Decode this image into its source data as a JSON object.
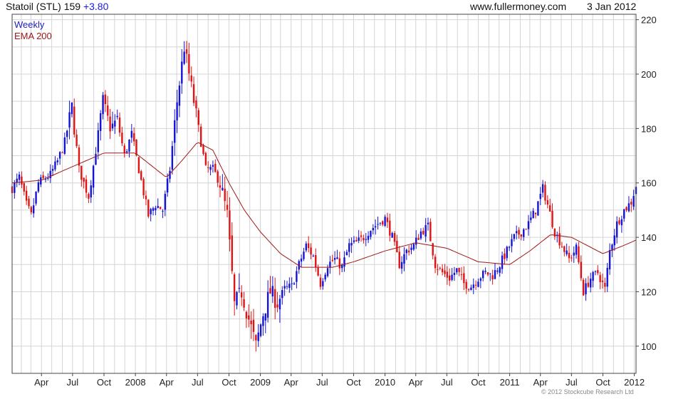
{
  "header": {
    "title": "Statoil (STL) 159",
    "change": "+3.80",
    "website": "www.fullermoney.com",
    "date": "3 Jan 2012"
  },
  "footer": {
    "copyright": "© 2012 Stockcube Research Ltd"
  },
  "colors": {
    "up": "#1414d8",
    "down": "#e01414",
    "ema": "#a01818",
    "grid": "#d4d4d4",
    "frame": "#444444"
  },
  "chart_data": {
    "type": "candlestick",
    "period": "Weekly",
    "legend": [
      "Weekly",
      "EMA 200"
    ],
    "ylim": [
      90,
      222
    ],
    "yticks": [
      100,
      120,
      140,
      160,
      180,
      200,
      220
    ],
    "xlim": [
      "2007-01-05",
      "2012-01-06"
    ],
    "xticks": [
      {
        "label": "Apr",
        "date": "2007-04-01"
      },
      {
        "label": "Jul",
        "date": "2007-07-01"
      },
      {
        "label": "Oct",
        "date": "2007-10-01"
      },
      {
        "label": "2008",
        "date": "2008-01-01"
      },
      {
        "label": "Apr",
        "date": "2008-04-01"
      },
      {
        "label": "Jul",
        "date": "2008-07-01"
      },
      {
        "label": "Oct",
        "date": "2008-10-01"
      },
      {
        "label": "2009",
        "date": "2009-01-01"
      },
      {
        "label": "Apr",
        "date": "2009-04-01"
      },
      {
        "label": "Jul",
        "date": "2009-07-01"
      },
      {
        "label": "Oct",
        "date": "2009-10-01"
      },
      {
        "label": "2010",
        "date": "2010-01-01"
      },
      {
        "label": "Apr",
        "date": "2010-04-01"
      },
      {
        "label": "Jul",
        "date": "2010-07-01"
      },
      {
        "label": "Oct",
        "date": "2010-10-01"
      },
      {
        "label": "2011",
        "date": "2011-01-01"
      },
      {
        "label": "Apr",
        "date": "2011-04-01"
      },
      {
        "label": "Jul",
        "date": "2011-07-01"
      },
      {
        "label": "Oct",
        "date": "2011-10-01"
      },
      {
        "label": "2012",
        "date": "2012-01-01"
      }
    ],
    "price_path": [
      [
        "2007-01-05",
        158
      ],
      [
        "2007-01-26",
        162
      ],
      [
        "2007-02-16",
        152
      ],
      [
        "2007-03-02",
        148
      ],
      [
        "2007-03-23",
        160
      ],
      [
        "2007-04-27",
        163
      ],
      [
        "2007-05-18",
        168
      ],
      [
        "2007-06-08",
        175
      ],
      [
        "2007-06-29",
        188
      ],
      [
        "2007-07-20",
        165
      ],
      [
        "2007-08-17",
        155
      ],
      [
        "2007-09-07",
        172
      ],
      [
        "2007-09-28",
        190
      ],
      [
        "2007-10-19",
        180
      ],
      [
        "2007-11-09",
        183
      ],
      [
        "2007-11-30",
        170
      ],
      [
        "2007-12-21",
        178
      ],
      [
        "2008-01-11",
        165
      ],
      [
        "2008-02-08",
        148
      ],
      [
        "2008-02-29",
        152
      ],
      [
        "2008-03-21",
        150
      ],
      [
        "2008-04-11",
        165
      ],
      [
        "2008-05-02",
        190
      ],
      [
        "2008-05-23",
        210
      ],
      [
        "2008-06-13",
        195
      ],
      [
        "2008-07-04",
        180
      ],
      [
        "2008-07-25",
        165
      ],
      [
        "2008-08-15",
        165
      ],
      [
        "2008-09-05",
        160
      ],
      [
        "2008-09-26",
        148
      ],
      [
        "2008-10-17",
        115
      ],
      [
        "2008-11-07",
        120
      ],
      [
        "2008-11-28",
        110
      ],
      [
        "2008-12-19",
        100
      ],
      [
        "2009-01-09",
        112
      ],
      [
        "2009-01-30",
        120
      ],
      [
        "2009-02-20",
        116
      ],
      [
        "2009-03-13",
        121
      ],
      [
        "2009-04-03",
        122
      ],
      [
        "2009-04-24",
        130
      ],
      [
        "2009-05-15",
        137
      ],
      [
        "2009-06-05",
        133
      ],
      [
        "2009-06-26",
        123
      ],
      [
        "2009-07-17",
        130
      ],
      [
        "2009-08-07",
        132
      ],
      [
        "2009-08-28",
        129
      ],
      [
        "2009-09-18",
        137
      ],
      [
        "2009-10-09",
        138
      ],
      [
        "2009-10-30",
        140
      ],
      [
        "2009-11-20",
        143
      ],
      [
        "2009-12-11",
        145
      ],
      [
        "2010-01-01",
        147
      ],
      [
        "2010-01-22",
        140
      ],
      [
        "2010-02-12",
        130
      ],
      [
        "2010-03-05",
        135
      ],
      [
        "2010-03-26",
        137
      ],
      [
        "2010-04-16",
        142
      ],
      [
        "2010-05-07",
        144
      ],
      [
        "2010-05-28",
        130
      ],
      [
        "2010-06-18",
        127
      ],
      [
        "2010-07-09",
        125
      ],
      [
        "2010-07-30",
        128
      ],
      [
        "2010-08-20",
        123
      ],
      [
        "2010-09-10",
        122
      ],
      [
        "2010-10-01",
        125
      ],
      [
        "2010-10-22",
        127
      ],
      [
        "2010-11-12",
        126
      ],
      [
        "2010-12-03",
        130
      ],
      [
        "2010-12-24",
        135
      ],
      [
        "2011-01-14",
        140
      ],
      [
        "2011-02-04",
        142
      ],
      [
        "2011-02-25",
        145
      ],
      [
        "2011-03-18",
        150
      ],
      [
        "2011-04-08",
        158
      ],
      [
        "2011-04-22",
        152
      ],
      [
        "2011-05-13",
        142
      ],
      [
        "2011-06-03",
        137
      ],
      [
        "2011-06-24",
        132
      ],
      [
        "2011-07-15",
        136
      ],
      [
        "2011-08-05",
        120
      ],
      [
        "2011-08-26",
        125
      ],
      [
        "2011-09-16",
        127
      ],
      [
        "2011-10-07",
        121
      ],
      [
        "2011-10-21",
        135
      ],
      [
        "2011-11-11",
        145
      ],
      [
        "2011-12-02",
        150
      ],
      [
        "2011-12-23",
        153
      ],
      [
        "2012-01-06",
        159
      ]
    ],
    "ema_200": [
      [
        "2007-01-05",
        160
      ],
      [
        "2007-04-01",
        161
      ],
      [
        "2007-07-01",
        166
      ],
      [
        "2007-10-01",
        171
      ],
      [
        "2008-01-01",
        171
      ],
      [
        "2008-04-01",
        162
      ],
      [
        "2008-05-15",
        168
      ],
      [
        "2008-07-01",
        175
      ],
      [
        "2008-08-15",
        172
      ],
      [
        "2008-10-01",
        160
      ],
      [
        "2008-11-15",
        150
      ],
      [
        "2009-01-01",
        142
      ],
      [
        "2009-03-01",
        134
      ],
      [
        "2009-05-01",
        129
      ],
      [
        "2009-08-01",
        129
      ],
      [
        "2009-10-01",
        131
      ],
      [
        "2010-01-01",
        135
      ],
      [
        "2010-04-01",
        138
      ],
      [
        "2010-07-01",
        136
      ],
      [
        "2010-10-01",
        131
      ],
      [
        "2011-01-01",
        130
      ],
      [
        "2011-03-01",
        135
      ],
      [
        "2011-05-01",
        141
      ],
      [
        "2011-07-01",
        140
      ],
      [
        "2011-10-01",
        134
      ],
      [
        "2011-12-01",
        137
      ],
      [
        "2012-01-06",
        139
      ]
    ]
  }
}
